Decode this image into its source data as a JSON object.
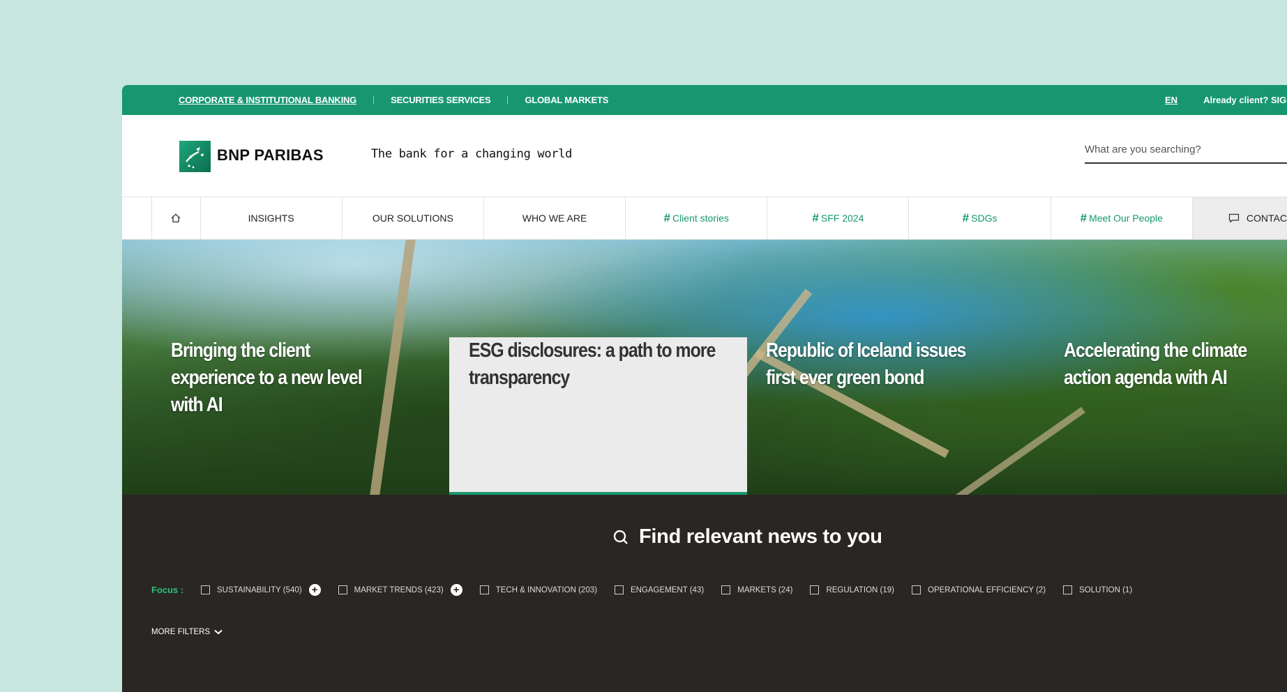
{
  "topbar": {
    "links": [
      "CORPORATE & INSTITUTIONAL BANKING",
      "SECURITIES SERVICES",
      "GLOBAL MARKETS"
    ],
    "language": "EN",
    "signin": "Already client? SIGN"
  },
  "header": {
    "brand": "BNP PARIBAS",
    "tagline": "The bank for a changing world",
    "search_placeholder": "What are you searching?"
  },
  "nav": {
    "items": [
      "INSIGHTS",
      "OUR SOLUTIONS",
      "WHO WE ARE"
    ],
    "tags": [
      "Client stories",
      "SFF 2024",
      "SDGs",
      "Meet Our People"
    ],
    "tag_prefix": "#",
    "contact": "CONTAC"
  },
  "hero": {
    "cards": [
      "Bringing the client experience to a new level with AI",
      "ESG disclosures: a path to more transparency",
      "Republic of Iceland issues first ever green bond",
      "Accelerating the climate action agenda with AI"
    ]
  },
  "news": {
    "headline": "Find relevant news to you",
    "focus_label": "Focus :",
    "filters": [
      "SUSTAINABILITY (540)",
      "MARKET TRENDS (423)",
      "TECH & INNOVATION (203)",
      "ENGAGEMENT (43)",
      "MARKETS (24)",
      "REGULATION (19)",
      "OPERATIONAL EFFICIENCY (2)",
      "SOLUTION (1)"
    ],
    "more_filters": "MORE FILTERS"
  },
  "colors": {
    "brand_green": "#17966f",
    "dark_bg": "#2a2624",
    "page_bg": "#c6e6df"
  }
}
